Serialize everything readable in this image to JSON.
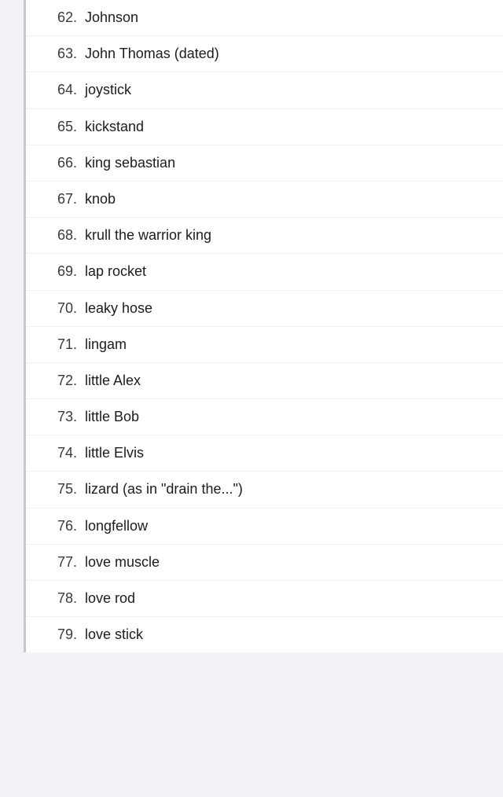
{
  "list": {
    "items": [
      {
        "number": "62.",
        "text": "Johnson"
      },
      {
        "number": "63.",
        "text": "John Thomas (dated)"
      },
      {
        "number": "64.",
        "text": "joystick"
      },
      {
        "number": "65.",
        "text": "kickstand"
      },
      {
        "number": "66.",
        "text": "king sebastian"
      },
      {
        "number": "67.",
        "text": "knob"
      },
      {
        "number": "68.",
        "text": "krull the warrior king"
      },
      {
        "number": "69.",
        "text": "lap rocket"
      },
      {
        "number": "70.",
        "text": "leaky hose"
      },
      {
        "number": "71.",
        "text": "lingam"
      },
      {
        "number": "72.",
        "text": "little Alex"
      },
      {
        "number": "73.",
        "text": "little Bob"
      },
      {
        "number": "74.",
        "text": "little Elvis"
      },
      {
        "number": "75.",
        "text": "lizard (as in \"drain the...\")"
      },
      {
        "number": "76.",
        "text": "longfellow"
      },
      {
        "number": "77.",
        "text": "love muscle"
      },
      {
        "number": "78.",
        "text": "love rod"
      },
      {
        "number": "79.",
        "text": "love stick"
      }
    ]
  }
}
